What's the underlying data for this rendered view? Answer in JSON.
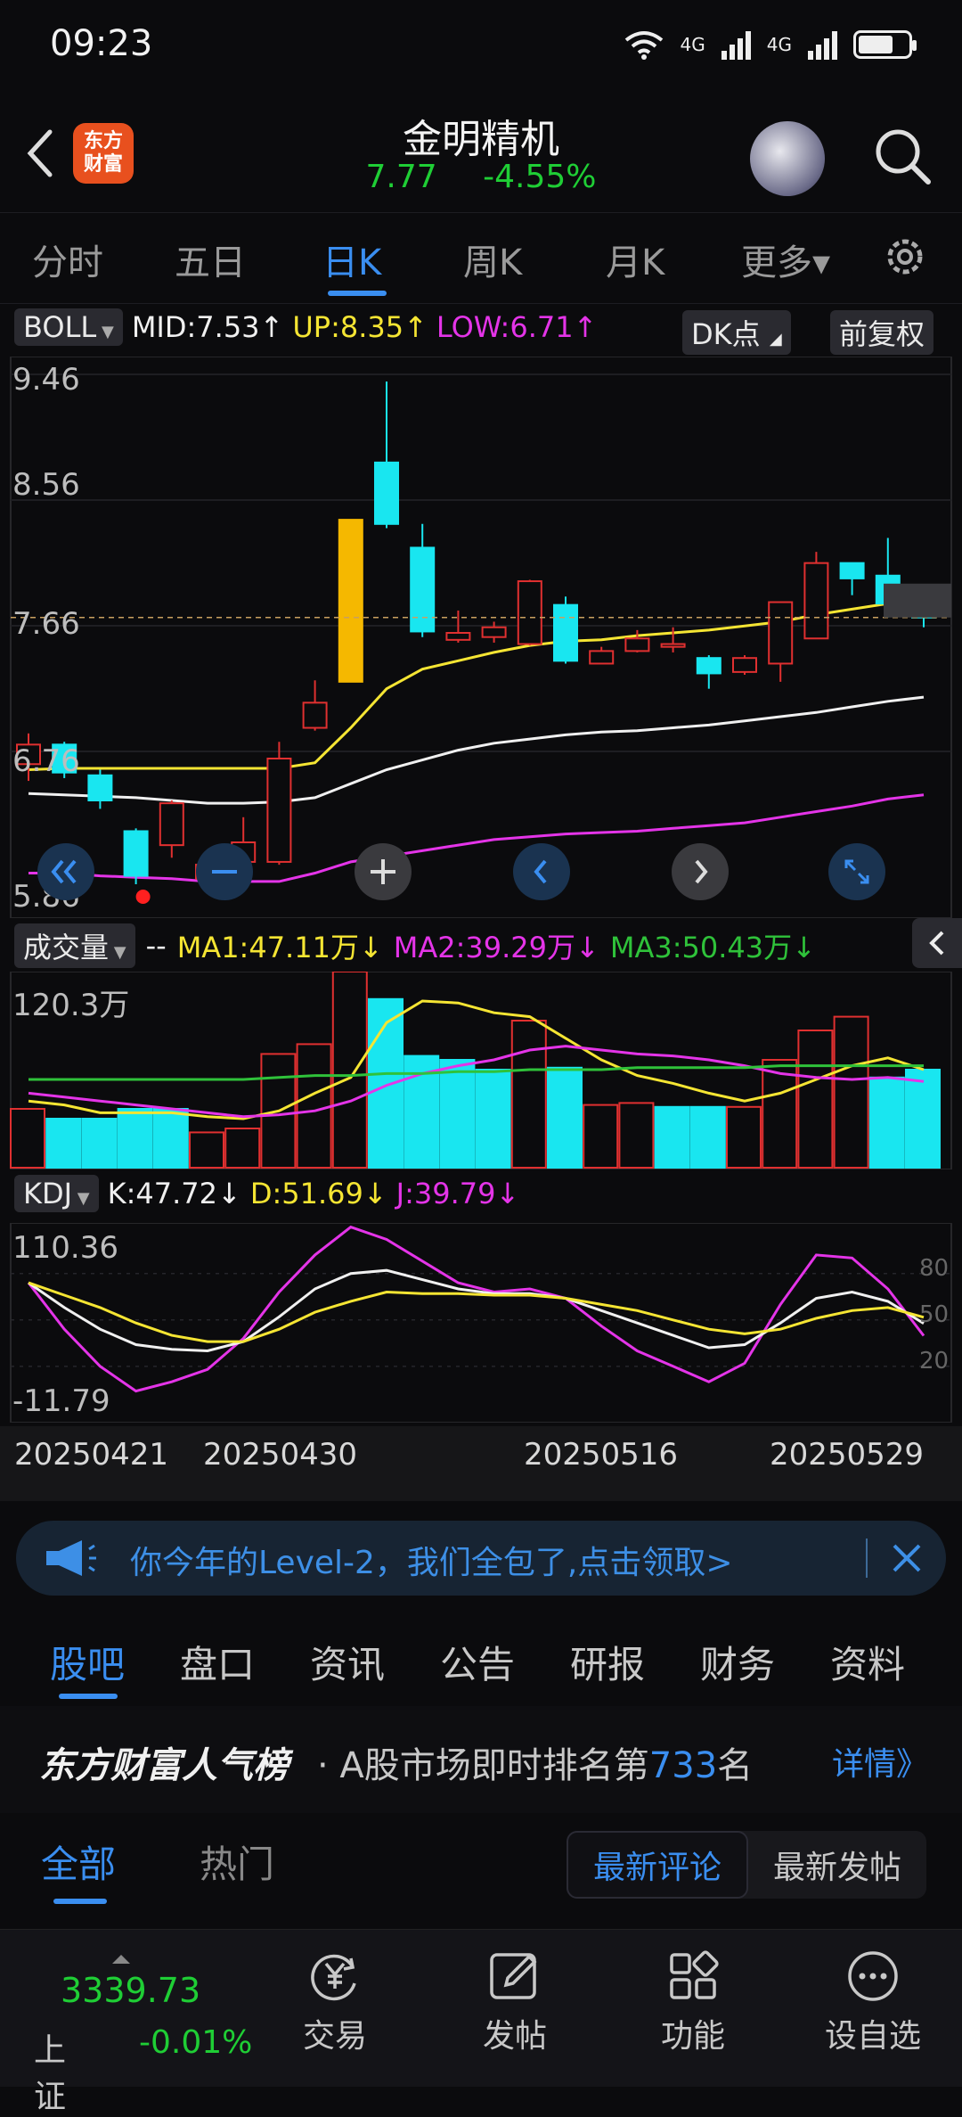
{
  "status": {
    "time": "09:23",
    "net1": "4G",
    "net2": "4G",
    "battery_level": 0.7
  },
  "header": {
    "logo_line1": "东方",
    "logo_line2": "财富",
    "title": "金明精机",
    "price": "7.77",
    "change": "-4.55%"
  },
  "period_tabs": [
    {
      "label": "分时"
    },
    {
      "label": "五日"
    },
    {
      "label": "日K",
      "active": true
    },
    {
      "label": "周K"
    },
    {
      "label": "月K"
    },
    {
      "label": "更多▾"
    }
  ],
  "boll": {
    "name": "BOLL",
    "mid": "MID:7.53↑",
    "up": "UP:8.35↑",
    "low": "LOW:6.71↑",
    "dk": "DK点",
    "adj": "前复权",
    "axis": [
      "9.46",
      "8.56",
      "7.66",
      "6.76",
      "5.86"
    ]
  },
  "volume": {
    "name": "成交量",
    "dash": "--",
    "ma1": "MA1:47.11万↓",
    "ma2": "MA2:39.29万↓",
    "ma3": "MA3:50.43万↓",
    "axis": "120.3万"
  },
  "kdj": {
    "name": "KDJ",
    "k": "K:47.72↓",
    "d": "D:51.69↓",
    "j": "J:39.79↓",
    "axis_top": "110.36",
    "axis_bottom": "-11.79",
    "levels": [
      "80",
      "50",
      "20"
    ]
  },
  "dates": [
    "20250421",
    "20250430",
    "20250516",
    "20250529"
  ],
  "chart_data": {
    "type": "candlestick",
    "price_axis": {
      "min": 5.86,
      "max": 9.46
    },
    "candles": [
      {
        "o": 6.72,
        "c": 6.86,
        "h": 6.94,
        "l": 6.6
      },
      {
        "o": 6.86,
        "c": 6.66,
        "h": 6.88,
        "l": 6.62
      },
      {
        "o": 6.64,
        "c": 6.46,
        "h": 6.68,
        "l": 6.4
      },
      {
        "o": 6.24,
        "c": 5.92,
        "h": 6.26,
        "l": 5.86
      },
      {
        "o": 6.14,
        "c": 6.44,
        "h": 6.46,
        "l": 6.05
      },
      {
        "o": 5.9,
        "c": 6.0,
        "h": 6.02,
        "l": 5.8
      },
      {
        "o": 6.02,
        "c": 6.16,
        "h": 6.34,
        "l": 5.95
      },
      {
        "o": 6.02,
        "c": 6.76,
        "h": 6.88,
        "l": 6.0
      },
      {
        "o": 6.98,
        "c": 7.16,
        "h": 7.32,
        "l": 6.96
      },
      {
        "o": 7.31,
        "c": 8.47,
        "h": 8.47,
        "l": 7.31,
        "limit_up": true
      },
      {
        "o": 8.88,
        "c": 8.44,
        "h": 9.46,
        "l": 8.41
      },
      {
        "o": 8.27,
        "c": 7.67,
        "h": 8.44,
        "l": 7.63
      },
      {
        "o": 7.61,
        "c": 7.66,
        "h": 7.82,
        "l": 7.59
      },
      {
        "o": 7.63,
        "c": 7.7,
        "h": 7.74,
        "l": 7.59
      },
      {
        "o": 7.58,
        "c": 8.03,
        "h": 8.04,
        "l": 7.57
      },
      {
        "o": 7.86,
        "c": 7.46,
        "h": 7.92,
        "l": 7.44
      },
      {
        "o": 7.44,
        "c": 7.53,
        "h": 7.56,
        "l": 7.44
      },
      {
        "o": 7.53,
        "c": 7.62,
        "h": 7.68,
        "l": 7.52
      },
      {
        "o": 7.56,
        "c": 7.58,
        "h": 7.7,
        "l": 7.52
      },
      {
        "o": 7.48,
        "c": 7.37,
        "h": 7.5,
        "l": 7.26
      },
      {
        "o": 7.38,
        "c": 7.48,
        "h": 7.5,
        "l": 7.36
      },
      {
        "o": 7.44,
        "c": 7.88,
        "h": 7.88,
        "l": 7.31
      },
      {
        "o": 7.62,
        "c": 8.16,
        "h": 8.24,
        "l": 7.62
      },
      {
        "o": 8.16,
        "c": 8.05,
        "h": 8.15,
        "l": 7.93
      },
      {
        "o": 8.07,
        "c": 7.87,
        "h": 8.34,
        "l": 7.77
      },
      {
        "o": 7.82,
        "c": 7.77,
        "h": 7.82,
        "l": 7.7,
        "current": true
      }
    ],
    "boll_mid": [
      6.68,
      6.69,
      6.69,
      6.69,
      6.69,
      6.69,
      6.69,
      6.69,
      6.73,
      6.98,
      7.26,
      7.4,
      7.46,
      7.52,
      7.57,
      7.6,
      7.61,
      7.64,
      7.66,
      7.68,
      7.71,
      7.74,
      7.79,
      7.83,
      7.87,
      7.9
    ],
    "boll_low": [
      6.51,
      6.5,
      6.49,
      6.48,
      6.46,
      6.44,
      6.44,
      6.45,
      6.48,
      6.58,
      6.68,
      6.75,
      6.82,
      6.87,
      6.9,
      6.93,
      6.95,
      6.96,
      6.98,
      7.0,
      7.03,
      7.06,
      7.09,
      7.13,
      7.17,
      7.2
    ],
    "boll_bottom": [
      5.94,
      5.94,
      5.92,
      5.91,
      5.9,
      5.88,
      5.88,
      5.88,
      5.94,
      6.02,
      6.06,
      6.1,
      6.14,
      6.18,
      6.2,
      6.22,
      6.23,
      6.24,
      6.26,
      6.28,
      6.3,
      6.34,
      6.38,
      6.42,
      6.47,
      6.5
    ],
    "volume": [
      0.3,
      0.25,
      0.25,
      0.3,
      0.3,
      0.18,
      0.2,
      0.58,
      0.63,
      1.0,
      0.86,
      0.57,
      0.55,
      0.5,
      0.75,
      0.51,
      0.32,
      0.33,
      0.31,
      0.31,
      0.31,
      0.55,
      0.7,
      0.77,
      0.46,
      0.5
    ],
    "volume_up": [
      true,
      false,
      false,
      false,
      false,
      true,
      true,
      true,
      true,
      true,
      false,
      false,
      false,
      false,
      true,
      false,
      true,
      true,
      false,
      false,
      true,
      true,
      true,
      true,
      false,
      false
    ],
    "ma1": [
      0.34,
      0.32,
      0.28,
      0.28,
      0.28,
      0.26,
      0.25,
      0.29,
      0.38,
      0.46,
      0.74,
      0.85,
      0.84,
      0.79,
      0.77,
      0.66,
      0.55,
      0.47,
      0.43,
      0.38,
      0.34,
      0.38,
      0.45,
      0.52,
      0.56,
      0.5
    ],
    "ma2": [
      0.38,
      0.36,
      0.34,
      0.32,
      0.3,
      0.28,
      0.26,
      0.27,
      0.29,
      0.34,
      0.42,
      0.48,
      0.52,
      0.55,
      0.6,
      0.62,
      0.6,
      0.58,
      0.57,
      0.55,
      0.52,
      0.48,
      0.46,
      0.45,
      0.46,
      0.44
    ],
    "ma3": [
      0.45,
      0.45,
      0.45,
      0.45,
      0.45,
      0.45,
      0.45,
      0.46,
      0.47,
      0.47,
      0.48,
      0.48,
      0.49,
      0.49,
      0.5,
      0.5,
      0.5,
      0.51,
      0.51,
      0.51,
      0.51,
      0.52,
      0.52,
      0.52,
      0.52,
      0.52
    ],
    "kdj_axis": {
      "min": -11.79,
      "max": 110.36
    },
    "k": [
      74,
      58,
      44,
      34,
      31,
      30,
      36,
      52,
      70,
      80,
      82,
      76,
      70,
      67,
      67,
      64,
      56,
      48,
      40,
      32,
      34,
      48,
      64,
      68,
      62,
      47.72
    ],
    "d": [
      74,
      66,
      58,
      48,
      40,
      36,
      36,
      44,
      55,
      62,
      68,
      67,
      67,
      66,
      66,
      64,
      60,
      56,
      50,
      44,
      41,
      44,
      51,
      56,
      58,
      51.69
    ],
    "j": [
      74,
      44,
      20,
      4,
      10,
      18,
      38,
      68,
      92,
      110,
      102,
      88,
      74,
      68,
      70,
      64,
      46,
      30,
      20,
      10,
      22,
      60,
      92,
      90,
      70,
      39.79
    ]
  },
  "banner": {
    "text": "你今年的Level-2，我们全包了,点击领取>"
  },
  "bottom_tabs": [
    {
      "label": "股吧",
      "active": true
    },
    {
      "label": "盘口"
    },
    {
      "label": "资讯"
    },
    {
      "label": "公告"
    },
    {
      "label": "研报"
    },
    {
      "label": "财务"
    },
    {
      "label": "资料"
    }
  ],
  "rank": {
    "brand": "东方财富人气榜",
    "text_pre": "· A股市场即时排名第",
    "rank": "733",
    "text_post": "名",
    "more": "详情》"
  },
  "filter": {
    "all": "全部",
    "hot": "热门",
    "seg1": "最新评论",
    "seg2": "最新发帖"
  },
  "nav": {
    "index_value": "3339.73",
    "index_name": "上证",
    "index_change": "-0.01%",
    "items": [
      {
        "label": "交易"
      },
      {
        "label": "发帖"
      },
      {
        "label": "功能"
      },
      {
        "label": "设自选"
      }
    ]
  },
  "colors": {
    "up": "#e03030",
    "down": "#19e6f0",
    "limit": "#f5b800",
    "accent": "#3a8ef0"
  }
}
